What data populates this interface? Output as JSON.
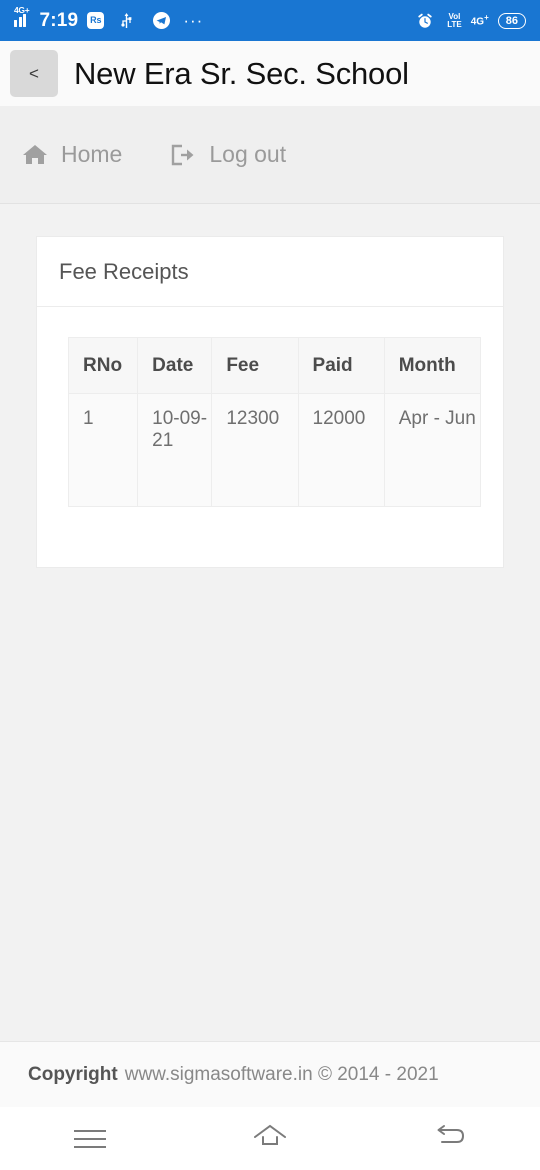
{
  "statusbar": {
    "network_label": "4G+",
    "time": "7:19",
    "app_badge": "Rs",
    "overflow": "···",
    "volte_top": "Vol",
    "volte_bottom": "LTE",
    "network_right": "4G",
    "network_right_sup": "+",
    "battery": "86",
    "bg_color": "#1976d2"
  },
  "titlebar": {
    "back_label": "<",
    "title": "New Era Sr. Sec. School"
  },
  "nav": {
    "items": [
      {
        "label": "Home",
        "icon": "home-icon"
      },
      {
        "label": "Log out",
        "icon": "sign-out-icon"
      }
    ]
  },
  "card": {
    "title": "Fee Receipts",
    "table": {
      "headers": [
        "RNo",
        "Date",
        "Fee",
        "Paid",
        "Month"
      ],
      "rows": [
        [
          "1",
          "10-09-21",
          "12300",
          "12000",
          "Apr - Jun"
        ]
      ]
    }
  },
  "footer": {
    "bold": "Copyright",
    "text": "www.sigmasoftware.in © 2014 - 2021"
  },
  "androidnav": {
    "recents": "recents-icon",
    "home": "home-icon",
    "back": "back-icon"
  }
}
